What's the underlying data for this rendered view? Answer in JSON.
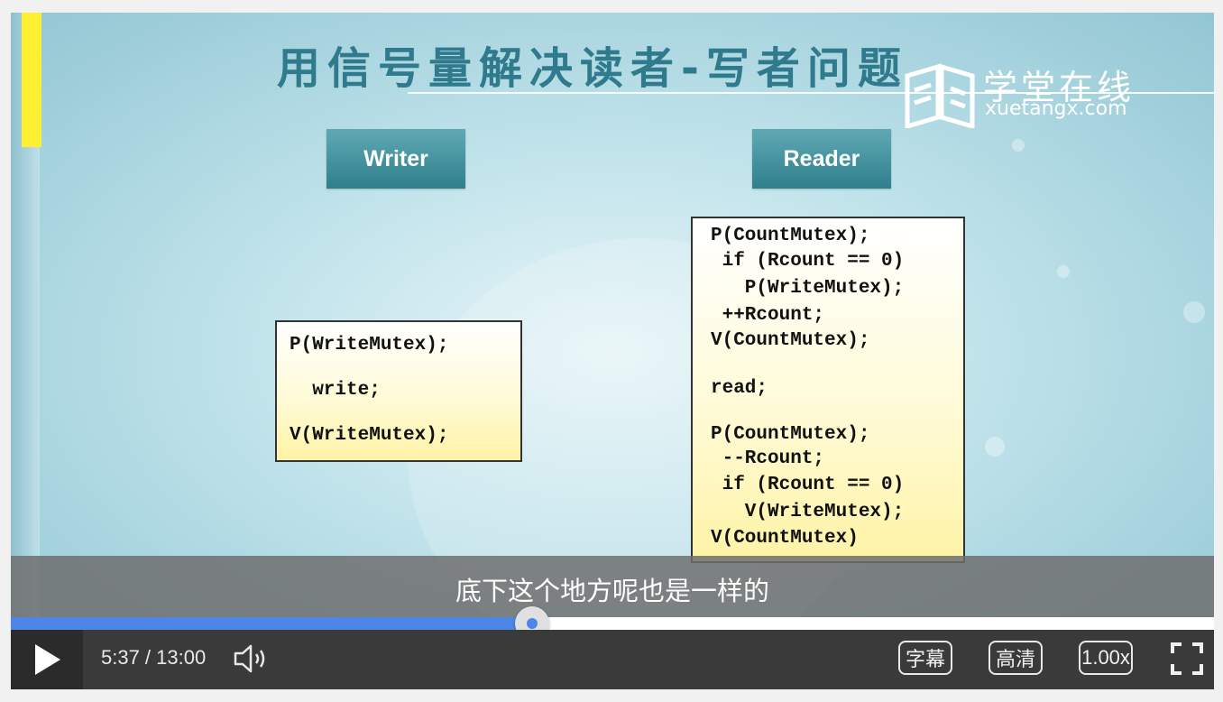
{
  "slide": {
    "title": "用信号量解决读者-写者问题",
    "logo_cn": "学堂在线",
    "logo_en": "xuetangx.com",
    "writer_label": "Writer",
    "reader_label": "Reader",
    "writer_code": [
      "P(WriteMutex);",
      "  write;",
      "V(WriteMutex);"
    ],
    "reader_code": [
      "P(CountMutex);",
      " if (Rcount == 0)",
      "   P(WriteMutex);",
      " ++Rcount;",
      "V(CountMutex);",
      "read;",
      "P(CountMutex);",
      " --Rcount;",
      " if (Rcount == 0)",
      "   V(WriteMutex);",
      "V(CountMutex)"
    ]
  },
  "subtitle": "底下这个地方呢也是一样的",
  "player": {
    "progress_fraction": 0.433,
    "time_display": "5:37 / 13:00",
    "subtitle_btn": "字幕",
    "quality_btn": "高清",
    "speed_btn": "1.00x",
    "play_icon": "play-icon",
    "volume_icon": "volume-icon",
    "fullscreen_icon": "fullscreen-icon"
  },
  "colors": {
    "accent": "#4d86e6",
    "title": "#2f7a8c",
    "code_bg": "#fff3a6"
  }
}
